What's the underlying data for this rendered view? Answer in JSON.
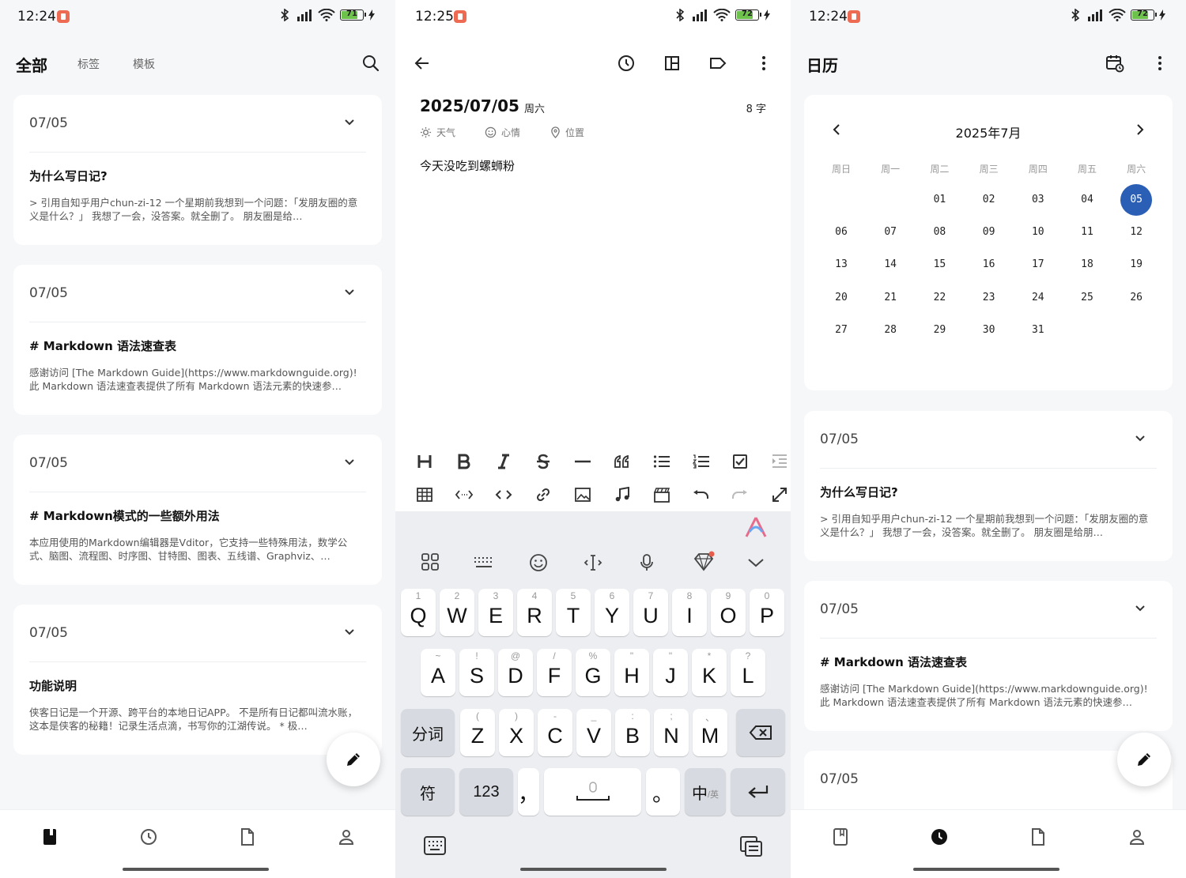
{
  "screens": {
    "list": {
      "status": {
        "time": "12:24",
        "battery": "71"
      },
      "tabs": [
        "全部",
        "标签",
        "模板"
      ],
      "cards": [
        {
          "date": "07/05",
          "title": "为什么写日记?",
          "excerpt": "> 引用自知乎用户chun-zi-12 一个星期前我想到一个问题：「发朋友圈的意义是什么？」 我想了一会，没答案。就全删了。 朋友圈是给…"
        },
        {
          "date": "07/05",
          "title": "# Markdown 语法速查表",
          "excerpt": "感谢访问 [The Markdown Guide](https://www.markdownguide.org)! 此 Markdown 语法速查表提供了所有 Markdown 语法元素的快速参…"
        },
        {
          "date": "07/05",
          "title": "# Markdown模式的一些额外用法",
          "excerpt": "本应用使用的Markdown编辑器是Vditor，它支持一些特殊用法，数学公式、脑图、流程图、时序图、甘特图、图表、五线谱、Graphviz、…"
        },
        {
          "date": "07/05",
          "title": "功能说明",
          "excerpt": "侠客日记是一个开源、跨平台的本地日记APP。 不是所有日记都叫流水账，这本是侠客的秘籍！记录生活点滴，书写你的江湖传说。 * 极…"
        }
      ]
    },
    "editor": {
      "status": {
        "time": "12:25",
        "battery": "72"
      },
      "date": "2025/07/05",
      "weekday": "周六",
      "word_count": "8 字",
      "meta": {
        "weather": "天气",
        "mood": "心情",
        "location": "位置"
      },
      "content": "今天没吃到螺蛳粉",
      "keyboard": {
        "row1": [
          {
            "k": "Q",
            "n": "1"
          },
          {
            "k": "W",
            "n": "2"
          },
          {
            "k": "E",
            "n": "3"
          },
          {
            "k": "R",
            "n": "4"
          },
          {
            "k": "T",
            "n": "5"
          },
          {
            "k": "Y",
            "n": "6"
          },
          {
            "k": "U",
            "n": "7"
          },
          {
            "k": "I",
            "n": "8"
          },
          {
            "k": "O",
            "n": "9"
          },
          {
            "k": "P",
            "n": "0"
          }
        ],
        "row2": [
          {
            "k": "A",
            "n": "~"
          },
          {
            "k": "S",
            "n": "!"
          },
          {
            "k": "D",
            "n": "@"
          },
          {
            "k": "F",
            "n": "/"
          },
          {
            "k": "G",
            "n": "%"
          },
          {
            "k": "H",
            "n": "\""
          },
          {
            "k": "J",
            "n": "\""
          },
          {
            "k": "K",
            "n": "*"
          },
          {
            "k": "L",
            "n": "?"
          }
        ],
        "row3": [
          {
            "k": "Z",
            "n": "("
          },
          {
            "k": "X",
            "n": ")"
          },
          {
            "k": "C",
            "n": "-"
          },
          {
            "k": "V",
            "n": "_"
          },
          {
            "k": "B",
            "n": ":"
          },
          {
            "k": "N",
            "n": ";"
          },
          {
            "k": "M",
            "n": "、"
          }
        ],
        "split": "分词",
        "symbols": "符",
        "numbers": "123",
        "comma": "，",
        "period": "。",
        "lang": "中",
        "lang_sub": "/英"
      }
    },
    "calendar": {
      "status": {
        "time": "12:24",
        "battery": "72"
      },
      "title": "日历",
      "month": "2025年7月",
      "weekdays": [
        "周日",
        "周一",
        "周二",
        "周三",
        "周四",
        "周五",
        "周六"
      ],
      "days": [
        "01",
        "02",
        "03",
        "04",
        "05",
        "06",
        "07",
        "08",
        "09",
        "10",
        "11",
        "12",
        "13",
        "14",
        "15",
        "16",
        "17",
        "18",
        "19",
        "20",
        "21",
        "22",
        "23",
        "24",
        "25",
        "26",
        "27",
        "28",
        "29",
        "30",
        "31"
      ],
      "first_weekday": 2,
      "selected": "05",
      "cards": [
        {
          "date": "07/05",
          "title": "为什么写日记?",
          "excerpt": "> 引用自知乎用户chun-zi-12 一个星期前我想到一个问题：「发朋友圈的意义是什么？」 我想了一会，没答案。就全删了。 朋友圈是给朋…"
        },
        {
          "date": "07/05",
          "title": "# Markdown 语法速查表",
          "excerpt": "感谢访问 [The Markdown Guide](https://www.markdownguide.org)! 此 Markdown 语法速查表提供了所有 Markdown 语法元素的快速参…"
        },
        {
          "date": "07/05"
        }
      ]
    }
  },
  "colors": {
    "accent": "#2b5fb5",
    "record": "#ee6b53",
    "battery": "#6cc24a"
  }
}
